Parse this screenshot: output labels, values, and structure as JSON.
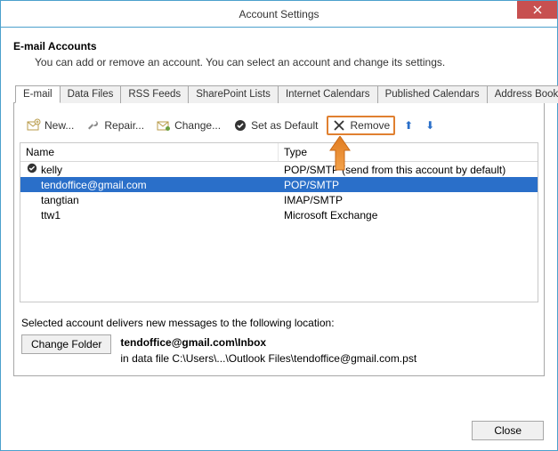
{
  "window": {
    "title": "Account Settings"
  },
  "header": {
    "title": "E-mail Accounts",
    "desc": "You can add or remove an account. You can select an account and change its settings."
  },
  "tabs": [
    {
      "label": "E-mail",
      "active": true
    },
    {
      "label": "Data Files"
    },
    {
      "label": "RSS Feeds"
    },
    {
      "label": "SharePoint Lists"
    },
    {
      "label": "Internet Calendars"
    },
    {
      "label": "Published Calendars"
    },
    {
      "label": "Address Books"
    }
  ],
  "toolbar": {
    "new": "New...",
    "repair": "Repair...",
    "change": "Change...",
    "set_default": "Set as Default",
    "remove": "Remove"
  },
  "columns": {
    "name": "Name",
    "type": "Type"
  },
  "accounts": [
    {
      "name": "kelly",
      "type": "POP/SMTP (send from this account by default)",
      "default": true,
      "selected": false
    },
    {
      "name": "tendoffice@gmail.com",
      "type": "POP/SMTP",
      "default": false,
      "selected": true
    },
    {
      "name": "tangtian",
      "type": "IMAP/SMTP",
      "default": false,
      "selected": false
    },
    {
      "name": "ttw1",
      "type": "Microsoft Exchange",
      "default": false,
      "selected": false
    }
  ],
  "delivery": {
    "note": "Selected account delivers new messages to the following location:",
    "change_folder": "Change Folder",
    "location_bold": "tendoffice@gmail.com\\Inbox",
    "location_detail": "in data file C:\\Users\\...\\Outlook Files\\tendoffice@gmail.com.pst"
  },
  "footer": {
    "close": "Close"
  }
}
